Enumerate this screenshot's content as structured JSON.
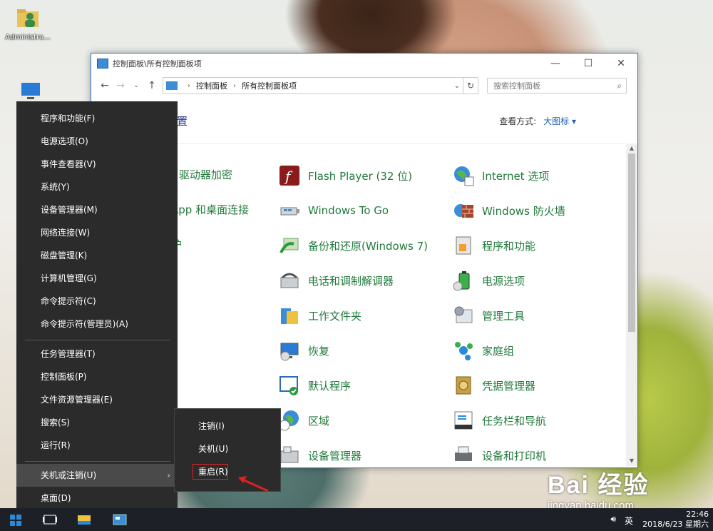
{
  "desktop": {
    "admin_label": "Administra..."
  },
  "window": {
    "title": "控制面板\\所有控制面板项",
    "breadcrumb": [
      "控制面板",
      "所有控制面板项"
    ],
    "search_placeholder": "搜索控制面板",
    "adjust_title_fragment": "置",
    "view_by_label": "查看方式:",
    "view_by_value": "大图标 ▾"
  },
  "partial_items": [
    "r 驱动器加密",
    "App 和桌面连接",
    "护"
  ],
  "cp_items_col1": [
    {
      "label": "Flash Player (32 位)",
      "icon": "flash-icon"
    },
    {
      "label": "Windows To Go",
      "icon": "usb-icon"
    },
    {
      "label": "备份和还原(Windows 7)",
      "icon": "backup-icon"
    },
    {
      "label": "电话和调制解调器",
      "icon": "phone-icon"
    },
    {
      "label": "工作文件夹",
      "icon": "folder-icon"
    },
    {
      "label": "恢复",
      "icon": "recovery-icon"
    },
    {
      "label": "默认程序",
      "icon": "default-programs-icon"
    },
    {
      "label": "区域",
      "icon": "globe-clock-icon"
    },
    {
      "label": "设备管理器",
      "icon": "device-manager-icon"
    }
  ],
  "cp_items_col2": [
    {
      "label": "Internet 选项",
      "icon": "internet-icon"
    },
    {
      "label": "Windows 防火墙",
      "icon": "firewall-icon"
    },
    {
      "label": "程序和功能",
      "icon": "programs-icon"
    },
    {
      "label": "电源选项",
      "icon": "battery-icon"
    },
    {
      "label": "管理工具",
      "icon": "admin-tools-icon"
    },
    {
      "label": "家庭组",
      "icon": "homegroup-icon"
    },
    {
      "label": "凭据管理器",
      "icon": "vault-icon"
    },
    {
      "label": "任务栏和导航",
      "icon": "taskbar-icon"
    },
    {
      "label": "设备和打印机",
      "icon": "printer-icon"
    }
  ],
  "winx_menu": [
    "程序和功能(F)",
    "电源选项(O)",
    "事件查看器(V)",
    "系统(Y)",
    "设备管理器(M)",
    "网络连接(W)",
    "磁盘管理(K)",
    "计算机管理(G)",
    "命令提示符(C)",
    "命令提示符(管理员)(A)",
    "任务管理器(T)",
    "控制面板(P)",
    "文件资源管理器(E)",
    "搜索(S)",
    "运行(R)",
    "关机或注销(U)",
    "桌面(D)"
  ],
  "submenu": [
    "注销(I)",
    "关机(U)",
    "重启(R)"
  ],
  "taskbar": {
    "time": "22:46",
    "date": "2018/6/23 星期六",
    "ime": "英"
  },
  "watermark": {
    "brand": "Bai 经验",
    "url": "jingyan.baidu.com"
  },
  "colors": {
    "item_green": "#227a3c",
    "menu_bg": "#2b2b2b",
    "taskbar_bg": "#1d2127",
    "highlight_red": "#e02020"
  }
}
